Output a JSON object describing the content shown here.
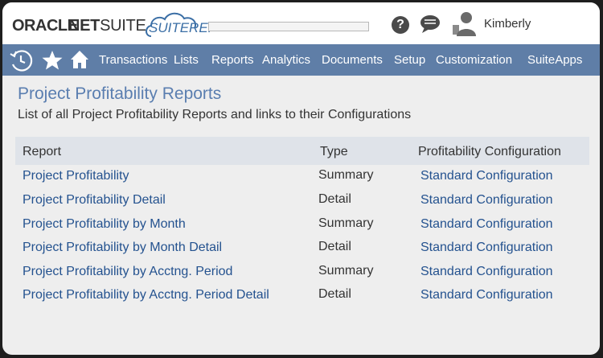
{
  "header": {
    "logo_oracle": "ORACLE",
    "logo_netsuite_bold": "NET",
    "logo_netsuite_rest": "SUITE",
    "suiterep_label": "SUITEREP",
    "user_name": "Kimberly",
    "help_glyph": "?"
  },
  "nav": {
    "icons": [
      "recent-clock-icon",
      "star-icon",
      "home-icon"
    ],
    "items": [
      "Transactions",
      "Lists",
      "Reports",
      "Analytics",
      "Documents",
      "Setup",
      "Customization",
      "SuiteApps"
    ]
  },
  "page": {
    "title": "Project Profitability Reports",
    "subtitle": "List of all Project Profitability Reports and links to their Configurations"
  },
  "table": {
    "headers": [
      "Report",
      "Type",
      "Profitability Configuration"
    ],
    "rows": [
      {
        "report": "Project Profitability",
        "type": "Summary",
        "config": "Standard Configuration"
      },
      {
        "report": "Project Profitability Detail",
        "type": "Detail",
        "config": "Standard Configuration"
      },
      {
        "report": "Project Profitability by Month",
        "type": "Summary",
        "config": "Standard Configuration"
      },
      {
        "report": "Project Profitability by Month Detail",
        "type": "Detail",
        "config": "Standard Configuration"
      },
      {
        "report": "Project Profitability by Acctng. Period",
        "type": "Summary",
        "config": "Standard Configuration"
      },
      {
        "report": "Project Profitability by Acctng. Period Detail",
        "type": "Detail",
        "config": "Standard Configuration"
      }
    ]
  },
  "colors": {
    "nav_bg": "#5f7ea7",
    "title": "#5a7eb0",
    "link": "#24528f",
    "header_row": "#dfe3e9"
  }
}
